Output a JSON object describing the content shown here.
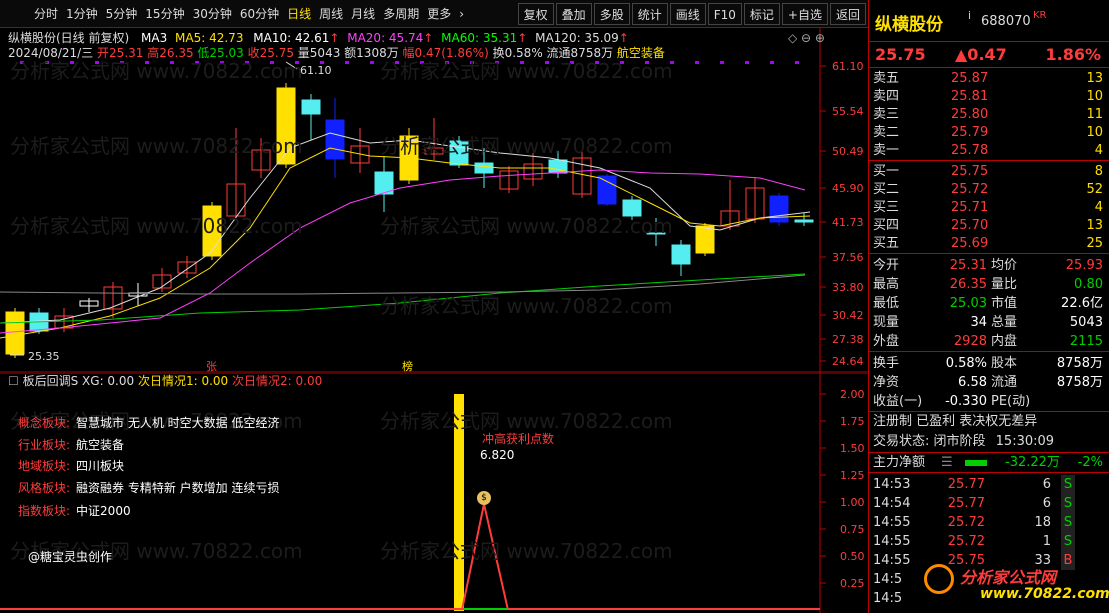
{
  "toolbar": {
    "periods": [
      "分时",
      "1分钟",
      "5分钟",
      "15分钟",
      "30分钟",
      "60分钟",
      "日线",
      "周线",
      "月线",
      "多周期",
      "更多"
    ],
    "active_period": "日线",
    "more_arrow": "›",
    "actions": [
      "复权",
      "叠加",
      "多股",
      "统计",
      "画线",
      "F10",
      "标记",
      "+自选",
      "返回"
    ]
  },
  "chart_header": {
    "title": "纵横股份(日线 前复权)",
    "ma3": "MA3",
    "ma5": "MA5: 42.73",
    "ma10": "MA10: 42.61",
    "ma20": "MA20: 45.74",
    "ma60": "MA60: 35.31",
    "ma120": "MA120: 35.09",
    "date": "2024/08/21/三",
    "open": "开25.31",
    "high": "高26.35",
    "low": "低25.03",
    "close": "收25.75",
    "vol": "量5043",
    "amount": "额1308万",
    "change": "幅0.47(1.86%)",
    "turnover": "换0.58%",
    "float": "流通8758万",
    "industry": "航空装备",
    "colors": {
      "ma3": "#ffffff",
      "ma5": "#ffe000",
      "ma10": "#ff40ff",
      "ma20": "#00ff00",
      "ma60": "#bbbbbb",
      "ma120": "#bbbbbb"
    }
  },
  "price_axis": [
    "61.10",
    "55.54",
    "50.49",
    "45.90",
    "41.73",
    "37.56",
    "33.80",
    "30.42",
    "27.38",
    "24.64"
  ],
  "markers": {
    "high": "61.10",
    "low": "25.35",
    "zhang": "张",
    "bang": "榜"
  },
  "indicator": {
    "title": "板后回调S",
    "xg": "XG: 0.00",
    "day1": "次日情况1: 0.00",
    "day2": "次日情况2: 0.00",
    "axis": [
      "2.00",
      "1.75",
      "1.50",
      "1.25",
      "1.00",
      "0.75",
      "0.50",
      "0.25"
    ]
  },
  "plates": [
    {
      "key": "概念板块:",
      "val": "智慧城市 无人机 时空大数据 低空经济"
    },
    {
      "key": "行业板块:",
      "val": "航空装备"
    },
    {
      "key": "地域板块:",
      "val": "四川板块"
    },
    {
      "key": "风格板块:",
      "val": "融资融券 专精特新 户数增加 连续亏损"
    },
    {
      "key": "指数板块:",
      "val": "中证2000"
    }
  ],
  "credit": "@糖宝灵虫创作",
  "peak": {
    "label": "冲高获利点数",
    "value": "6.820"
  },
  "quote": {
    "name": "纵横股份",
    "i": "i",
    "code": "688070",
    "kr": "KR",
    "price": "25.75",
    "change": "▲0.47",
    "pct": "1.86%"
  },
  "asks": [
    {
      "label": "卖五",
      "price": "25.87",
      "qty": "13"
    },
    {
      "label": "卖四",
      "price": "25.81",
      "qty": "10"
    },
    {
      "label": "卖三",
      "price": "25.80",
      "qty": "11"
    },
    {
      "label": "卖二",
      "price": "25.79",
      "qty": "10"
    },
    {
      "label": "卖一",
      "price": "25.78",
      "qty": "4"
    }
  ],
  "bids": [
    {
      "label": "买一",
      "price": "25.75",
      "qty": "8"
    },
    {
      "label": "买二",
      "price": "25.72",
      "qty": "52"
    },
    {
      "label": "买三",
      "price": "25.71",
      "qty": "4"
    },
    {
      "label": "买四",
      "price": "25.70",
      "qty": "13"
    },
    {
      "label": "买五",
      "price": "25.69",
      "qty": "25"
    }
  ],
  "stats": [
    {
      "a": "今开",
      "b": "25.31",
      "c": "均价",
      "d": "25.93",
      "bc": "red",
      "dc": "red"
    },
    {
      "a": "最高",
      "b": "26.35",
      "c": "量比",
      "d": "0.80",
      "bc": "red",
      "dc": "grn"
    },
    {
      "a": "最低",
      "b": "25.03",
      "c": "市值",
      "d": "22.6亿",
      "bc": "grn",
      "dc": "wht"
    },
    {
      "a": "现量",
      "b": "34",
      "c": "总量",
      "d": "5043",
      "bc": "wht",
      "dc": "wht"
    },
    {
      "a": "外盘",
      "b": "2928",
      "c": "内盘",
      "d": "2115",
      "bc": "red",
      "dc": "grn"
    }
  ],
  "stats2": [
    {
      "a": "换手",
      "b": "0.58%",
      "c": "股本",
      "d": "8758万",
      "bc": "wht",
      "dc": "wht"
    },
    {
      "a": "净资",
      "b": "6.58",
      "c": "流通",
      "d": "8758万",
      "bc": "wht",
      "dc": "wht"
    },
    {
      "a": "收益(一)",
      "b": "-0.330",
      "c": "PE(动)",
      "d": "",
      "bc": "wht",
      "dc": "wht"
    }
  ],
  "reg": "注册制 已盈利 表决权无差异",
  "trade_status": "交易状态: 闭市阶段",
  "trade_time": "15:30:09",
  "mainflow": {
    "label": "主力净额",
    "value": "-32.22万",
    "pct": "-2%"
  },
  "ticks": [
    {
      "t": "14:53",
      "p": "25.77",
      "n": "6",
      "s": "S"
    },
    {
      "t": "14:54",
      "p": "25.77",
      "n": "6",
      "s": "S"
    },
    {
      "t": "14:55",
      "p": "25.72",
      "n": "18",
      "s": "S"
    },
    {
      "t": "14:55",
      "p": "25.72",
      "n": "1",
      "s": "S"
    },
    {
      "t": "14:55",
      "p": "25.75",
      "n": "33",
      "s": "B"
    },
    {
      "t": "14:5",
      "p": "",
      "n": "",
      "s": ""
    },
    {
      "t": "14:5",
      "p": "",
      "n": "",
      "s": ""
    }
  ],
  "logo": {
    "top": "分析家公式网",
    "url": "www.70822.com"
  },
  "watermark": "分析家公式网 www.70822.com"
}
